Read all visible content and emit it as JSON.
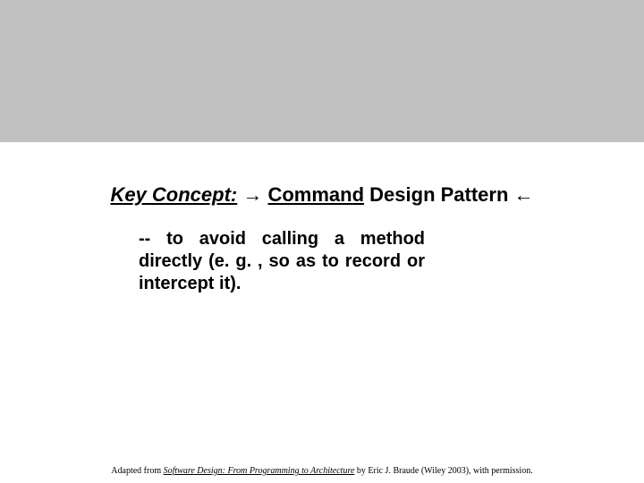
{
  "title": {
    "key_concept_label": "Key Concept:",
    "arrow_right": "→",
    "command_word": "Command",
    "design_pattern_words": " Design Pattern",
    "arrow_left": "←"
  },
  "body": {
    "text": "-- to avoid calling a method directly (e. g. , so as to record or intercept it)."
  },
  "attribution": {
    "prefix": "Adapted from ",
    "book_title": "Software Design: From Programming to Architecture",
    "suffix": " by Eric J. Braude (Wiley 2003), with permission."
  }
}
